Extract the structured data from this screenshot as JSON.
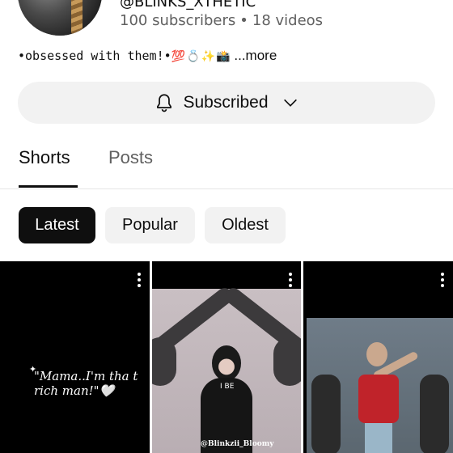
{
  "channel": {
    "handle": "@BLINKS_XTHETIC",
    "subscribers": "100 subscribers",
    "separator": "•",
    "videos": "18 videos",
    "bio_text": "•obsessed with them!•",
    "bio_emojis": "💯💍✨📸",
    "more_label": "...more"
  },
  "subscribe_button": {
    "label": "Subscribed",
    "icon": "bell-icon",
    "dropdown_icon": "chevron-down-icon"
  },
  "tabs": [
    {
      "label": "Shorts",
      "active": true
    },
    {
      "label": "Posts",
      "active": false
    }
  ],
  "filters": [
    {
      "label": "Latest",
      "selected": true
    },
    {
      "label": "Popular",
      "selected": false
    },
    {
      "label": "Oldest",
      "selected": false
    }
  ],
  "shorts": [
    {
      "caption": "\"Mama..I'm tha t rich man!\"🤍",
      "menu_icon": "more-vert-icon"
    },
    {
      "overlay_text": "I BE",
      "watermark": "@Blinkzii_Bloomy",
      "menu_icon": "more-vert-icon"
    },
    {
      "menu_icon": "more-vert-icon"
    }
  ],
  "colors": {
    "text_primary": "#0f0f0f",
    "text_secondary": "#606060",
    "chip_background": "#f2f2f2",
    "chip_selected": "#0f0f0f"
  }
}
